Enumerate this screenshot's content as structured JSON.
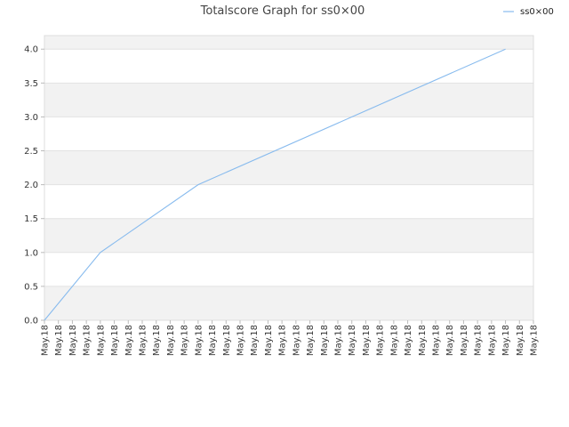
{
  "chart_data": {
    "type": "line",
    "title": "Totalscore Graph for ss0×00",
    "xlabel": "",
    "ylabel": "",
    "ylim": [
      0,
      4.2
    ],
    "yticks": [
      "0.0",
      "0.5",
      "1.0",
      "1.5",
      "2.0",
      "2.5",
      "3.0",
      "3.5",
      "4.0"
    ],
    "x_tick_labels": [
      "May.18",
      "May.18",
      "May.18",
      "May.18",
      "May.18",
      "May.18",
      "May.18",
      "May.18",
      "May.18",
      "May.18",
      "May.18",
      "May.18",
      "May.18",
      "May.18",
      "May.18",
      "May.18",
      "May.18",
      "May.18",
      "May.18",
      "May.18",
      "May.18",
      "May.18",
      "May.18",
      "May.18",
      "May.18",
      "May.18",
      "May.18",
      "May.18",
      "May.18",
      "May.18",
      "May.18",
      "May.18",
      "May.18",
      "May.18",
      "May.18",
      "May.18"
    ],
    "legend_position": "top-right",
    "grid": true,
    "band_colors": [
      "#f2f2f2",
      "#ffffff"
    ],
    "series": [
      {
        "name": "ss0×00",
        "color": "#88bbee",
        "points": [
          [
            0,
            0.0
          ],
          [
            4,
            1.0
          ],
          [
            11,
            2.0
          ],
          [
            33,
            4.0
          ]
        ]
      }
    ]
  }
}
